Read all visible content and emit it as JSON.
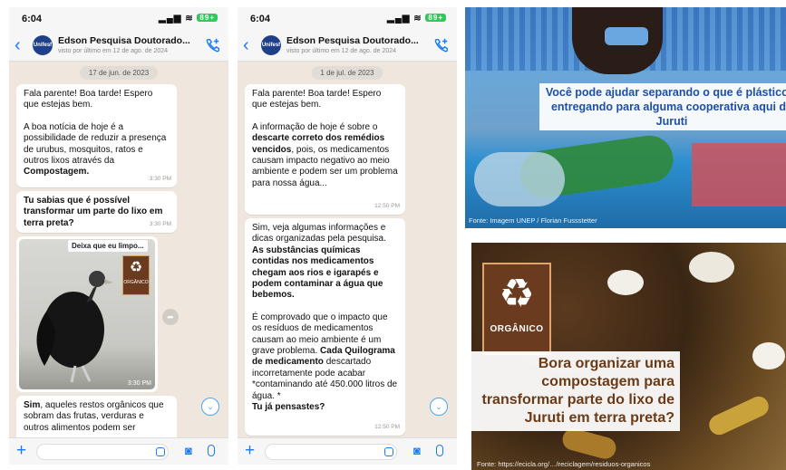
{
  "status": {
    "time": "6:04",
    "battery": "89+"
  },
  "chat_header": {
    "name": "Edson Pesquisa Doutorado...",
    "subtitle": "visto por último em 12 de ago. de 2024",
    "avatar_text": "Unifesf"
  },
  "screen1": {
    "date": "17 de jun. de 2023",
    "msg1": {
      "p1": "Fala parente! Boa tarde! Espero que estejas bem.",
      "p2_pre": "A boa notícia de hoje é a possibilidade de reduzir a presença de urubus, mosquitos, ratos e outros lixos através da ",
      "p2_bold": "Compostagem.",
      "time": "3:30 PM"
    },
    "msg2": {
      "text": "Tu sabias que é possível transformar um parte do lixo em terra preta?",
      "time": "3:30 PM"
    },
    "image_msg": {
      "caption": "Deixa que eu limpo...",
      "badge": "ORGÂNICO",
      "time": "3:30 PM"
    },
    "msg3": {
      "bold": "Sim",
      "text": ", aqueles restos orgânicos que sobram das frutas, verduras e outros alimentos podem ser"
    }
  },
  "screen2": {
    "date": "1 de jul. de 2023",
    "msg1": {
      "p1": "Fala parente! Boa tarde! Espero que estejas bem.",
      "p2_a": "A informação de hoje é sobre o ",
      "p2_b": "descarte correto dos remédios vencidos",
      "p2_c": ", pois, os medicamentos causam impacto negativo ao meio ambiente e podem ser um problema para nossa água...",
      "time": "12:50 PM"
    },
    "msg2": {
      "p1_a": "Sim, veja algumas informações e dicas organizadas pela pesquisa. ",
      "p1_b": "As substâncias químicas contidas nos medicamentos chegam aos rios e igarapés e podem contaminar a água que bebemos.",
      "p2_a": "É comprovado que o impacto que os resíduos de medicamentos causam ao meio ambiente é um grave problema. ",
      "p2_b": "Cada Quilograma de medicamento",
      "p2_c": " descartado incorretamente pode acabar *contaminando até 450.000 litros de água. *",
      "p3": "Tu já pensastes?",
      "time": "12:50 PM"
    }
  },
  "poster1": {
    "text": "Você pode ajudar separando o que é plástico e entregando para alguma cooperativa aqui de Juruti",
    "credit": "Fonte: Imagem UNEP / Florian Fussstetter"
  },
  "poster2": {
    "badge": "ORGÂNICO",
    "text": "Bora organizar uma compostagem para transformar parte do lixo de Juruti em terra preta?",
    "credit": "Fonte: https://ecicla.org/…/reciclagem/residuos-organicos"
  },
  "colors": {
    "accent": "#1a7cf5",
    "chat_bg": "#efe7dd",
    "poster1_text": "#1f4fa3",
    "poster2_text": "#6b3a16",
    "badge_bg": "#6a3b1e"
  },
  "icons": [
    "back-icon",
    "add-call-icon",
    "forward-icon",
    "chevron-down-icon",
    "plus-icon",
    "sticker-icon",
    "camera-icon",
    "mic-icon",
    "recycle-icon"
  ]
}
